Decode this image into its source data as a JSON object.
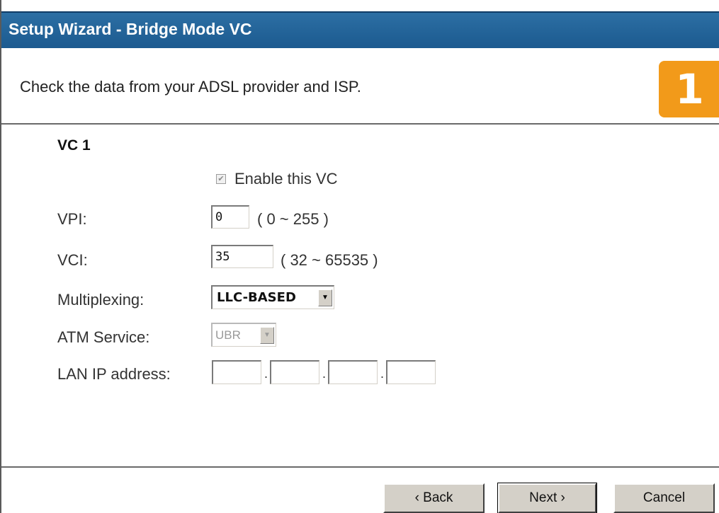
{
  "window": {
    "title": "Setup Wizard - Bridge Mode VC"
  },
  "header": {
    "instruction": "Check the data from your ADSL provider and ISP.",
    "step_number": "1"
  },
  "section": {
    "title": "VC 1"
  },
  "form": {
    "enable_vc": {
      "label": "Enable this VC",
      "checked": true
    },
    "vpi": {
      "label": "VPI:",
      "value": "0",
      "range": "( 0 ~ 255 )"
    },
    "vci": {
      "label": "VCI:",
      "value": "35",
      "range": "( 32 ~ 65535 )"
    },
    "multiplexing": {
      "label": "Multiplexing:",
      "selected": "LLC-BASED"
    },
    "atm_service": {
      "label": "ATM Service:",
      "selected": "UBR"
    },
    "lan_ip": {
      "label": "LAN IP address:",
      "octets": [
        "",
        "",
        "",
        ""
      ],
      "separator": "."
    }
  },
  "buttons": {
    "back": "‹ Back",
    "next": "Next ›",
    "cancel": "Cancel"
  },
  "colors": {
    "title_bar": "#1c5a8f",
    "step_badge": "#f29a1a"
  }
}
